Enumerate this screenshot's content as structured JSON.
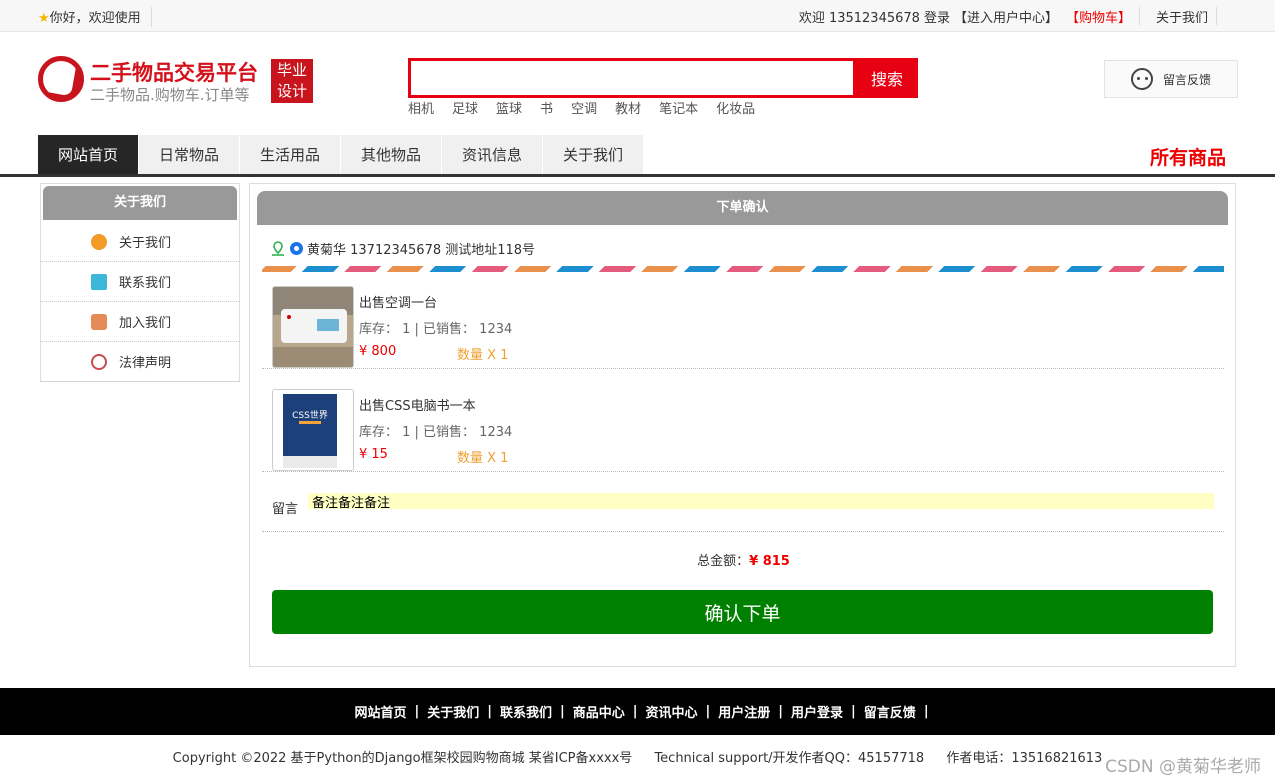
{
  "topbar": {
    "greeting": "你好，欢迎使用",
    "welcome": "欢迎 13512345678",
    "login": "登录",
    "user_center": "【进入用户中心】",
    "cart": "【购物车】",
    "about": "关于我们"
  },
  "header": {
    "site_title": "二手物品交易平台",
    "site_sub": "二手物品.购物车.订单等",
    "badge_line1": "毕业",
    "badge_line2": "设计",
    "search_button": "搜索",
    "search_value": "",
    "hotwords": [
      "相机",
      "足球",
      "篮球",
      "书",
      "空调",
      "教材",
      "笔记本",
      "化妆品"
    ],
    "feedback": "留言反馈"
  },
  "nav": {
    "items": [
      "网站首页",
      "日常物品",
      "生活用品",
      "其他物品",
      "资讯信息",
      "关于我们"
    ],
    "right_label": "所有商品"
  },
  "sidebar": {
    "title": "关于我们",
    "items": [
      {
        "label": "关于我们",
        "color": "#f39a28"
      },
      {
        "label": "联系我们",
        "color": "#3ab7d9"
      },
      {
        "label": "加入我们",
        "color": "#e58a57"
      },
      {
        "label": "法律声明",
        "color": "#c84b4b"
      }
    ]
  },
  "order": {
    "title": "下单确认",
    "address": "黄菊华 13712345678 测试地址118号",
    "products": [
      {
        "name": "出售空调一台",
        "stock": "库存： 1 | 已销售： 1234",
        "price": "¥ 800",
        "qty": "数量 X 1"
      },
      {
        "name": "出售CSS电脑书一本",
        "stock": "库存： 1 | 已销售： 1234",
        "price": "¥ 15",
        "qty": "数量 X 1"
      }
    ],
    "book_cover_text": "CSS世界",
    "remark_label": "留言",
    "remark_value": "备注备注备注",
    "total_label": "总金额：",
    "total_value": "¥ 815",
    "submit": "确认下单"
  },
  "footer": {
    "links": [
      "网站首页",
      "关于我们",
      "联系我们",
      "商品中心",
      "资讯中心",
      "用户注册",
      "用户登录",
      "留言反馈"
    ],
    "copyright": "Copyright ©2022 基于Python的Django框架校园购物商城 某省ICP备xxxx号",
    "support": "Technical support/开发作者QQ：45157718",
    "phone": "作者电话：13516821613",
    "watermark": "CSDN @黄菊华老师"
  }
}
